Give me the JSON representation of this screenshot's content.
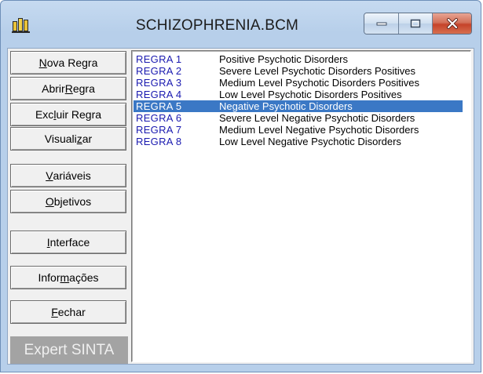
{
  "window": {
    "title": "SCHIZOPHRENIA.BCM"
  },
  "sidebar": {
    "buttons": [
      {
        "pre": "",
        "acc": "N",
        "post": "ova Regra"
      },
      {
        "pre": "Abrir ",
        "acc": "R",
        "post": "egra"
      },
      {
        "pre": "Exc",
        "acc": "l",
        "post": "uir Regra"
      },
      {
        "pre": "Visuali",
        "acc": "z",
        "post": "ar"
      },
      {
        "pre": "",
        "acc": "V",
        "post": "ariáveis"
      },
      {
        "pre": "",
        "acc": "O",
        "post": "bjetivos"
      },
      {
        "pre": "",
        "acc": "I",
        "post": "nterface"
      },
      {
        "pre": "Infor",
        "acc": "m",
        "post": "ações"
      },
      {
        "pre": "",
        "acc": "F",
        "post": "echar"
      }
    ],
    "logo_text": "Expert SINTA"
  },
  "rules": [
    {
      "id": "REGRA 1",
      "desc": "Positive Psychotic Disorders",
      "selected": false
    },
    {
      "id": "REGRA 2",
      "desc": "Severe Level Psychotic Disorders Positives",
      "selected": false
    },
    {
      "id": "REGRA 3",
      "desc": "Medium Level Psychotic Disorders Positives",
      "selected": false
    },
    {
      "id": "REGRA 4",
      "desc": "Low Level Psychotic Disorders Positives",
      "selected": false
    },
    {
      "id": "REGRA 5",
      "desc": "Negative Psychotic Disorders",
      "selected": true
    },
    {
      "id": "REGRA 6",
      "desc": "Severe Level Negative Psychotic Disorders",
      "selected": false
    },
    {
      "id": "REGRA 7",
      "desc": "Medium Level Negative Psychotic Disorders",
      "selected": false
    },
    {
      "id": "REGRA 8",
      "desc": "Low Level Negative Psychotic Disorders",
      "selected": false
    }
  ],
  "icons": {
    "app": "app-icon",
    "minimize": "minimize-icon",
    "maximize": "maximize-icon",
    "close": "close-icon"
  },
  "colors": {
    "selection": "#3b78c5",
    "rule_id": "#1a1ab0",
    "close_button": "#c5432a"
  }
}
